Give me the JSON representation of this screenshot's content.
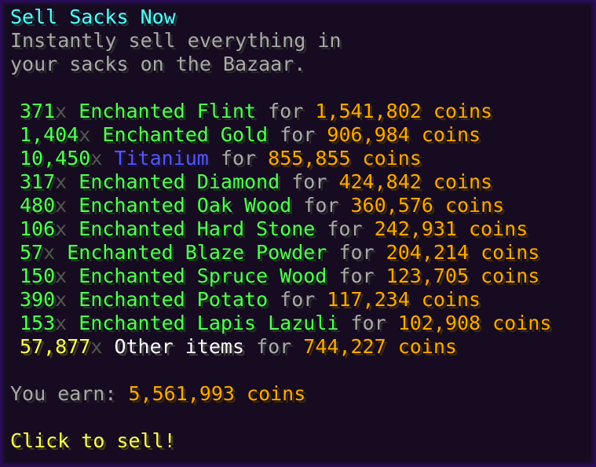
{
  "tooltip": {
    "title": "Sell Sacks Now",
    "description": [
      "Instantly sell everything in",
      "your sacks on the Bazaar."
    ],
    "items": [
      {
        "qty": "371",
        "x": "x",
        "name": "Enchanted Flint",
        "for": "for",
        "coins": "1,541,802 coins",
        "name_color": "green",
        "qty_color": "green"
      },
      {
        "qty": "1,404",
        "x": "x",
        "name": "Enchanted Gold",
        "for": "for",
        "coins": "906,984 coins",
        "name_color": "green",
        "qty_color": "green"
      },
      {
        "qty": "10,450",
        "x": "x",
        "name": "Titanium",
        "for": "for",
        "coins": "855,855 coins",
        "name_color": "blue",
        "qty_color": "green"
      },
      {
        "qty": "317",
        "x": "x",
        "name": "Enchanted Diamond",
        "for": "for",
        "coins": "424,842 coins",
        "name_color": "green",
        "qty_color": "green"
      },
      {
        "qty": "480",
        "x": "x",
        "name": "Enchanted Oak Wood",
        "for": "for",
        "coins": "360,576 coins",
        "name_color": "green",
        "qty_color": "green"
      },
      {
        "qty": "106",
        "x": "x",
        "name": "Enchanted Hard Stone",
        "for": "for",
        "coins": "242,931 coins",
        "name_color": "green",
        "qty_color": "green"
      },
      {
        "qty": "57",
        "x": "x",
        "name": "Enchanted Blaze Powder",
        "for": "for",
        "coins": "204,214 coins",
        "name_color": "green",
        "qty_color": "green"
      },
      {
        "qty": "150",
        "x": "x",
        "name": "Enchanted Spruce Wood",
        "for": "for",
        "coins": "123,705 coins",
        "name_color": "green",
        "qty_color": "green"
      },
      {
        "qty": "390",
        "x": "x",
        "name": "Enchanted Potato",
        "for": "for",
        "coins": "117,234 coins",
        "name_color": "green",
        "qty_color": "green"
      },
      {
        "qty": "153",
        "x": "x",
        "name": "Enchanted Lapis Lazuli",
        "for": "for",
        "coins": "102,908 coins",
        "name_color": "green",
        "qty_color": "green"
      },
      {
        "qty": "57,877",
        "x": "x",
        "name": "Other items",
        "for": "for",
        "coins": "744,227 coins",
        "name_color": "white",
        "qty_color": "yellow"
      }
    ],
    "earn_label": "You earn: ",
    "earn_value": "5,561,993 coins",
    "cta": "Click to sell!"
  },
  "colors": {
    "title": "#55ffff",
    "gray": "#aaaaaa",
    "green": "#55ff55",
    "blue": "#5555ff",
    "gold": "#ffaa00",
    "yellow": "#ffff55",
    "white": "#ffffff",
    "dark_gray": "#555555",
    "background": "#160b20",
    "border": "#2a0a5a"
  }
}
